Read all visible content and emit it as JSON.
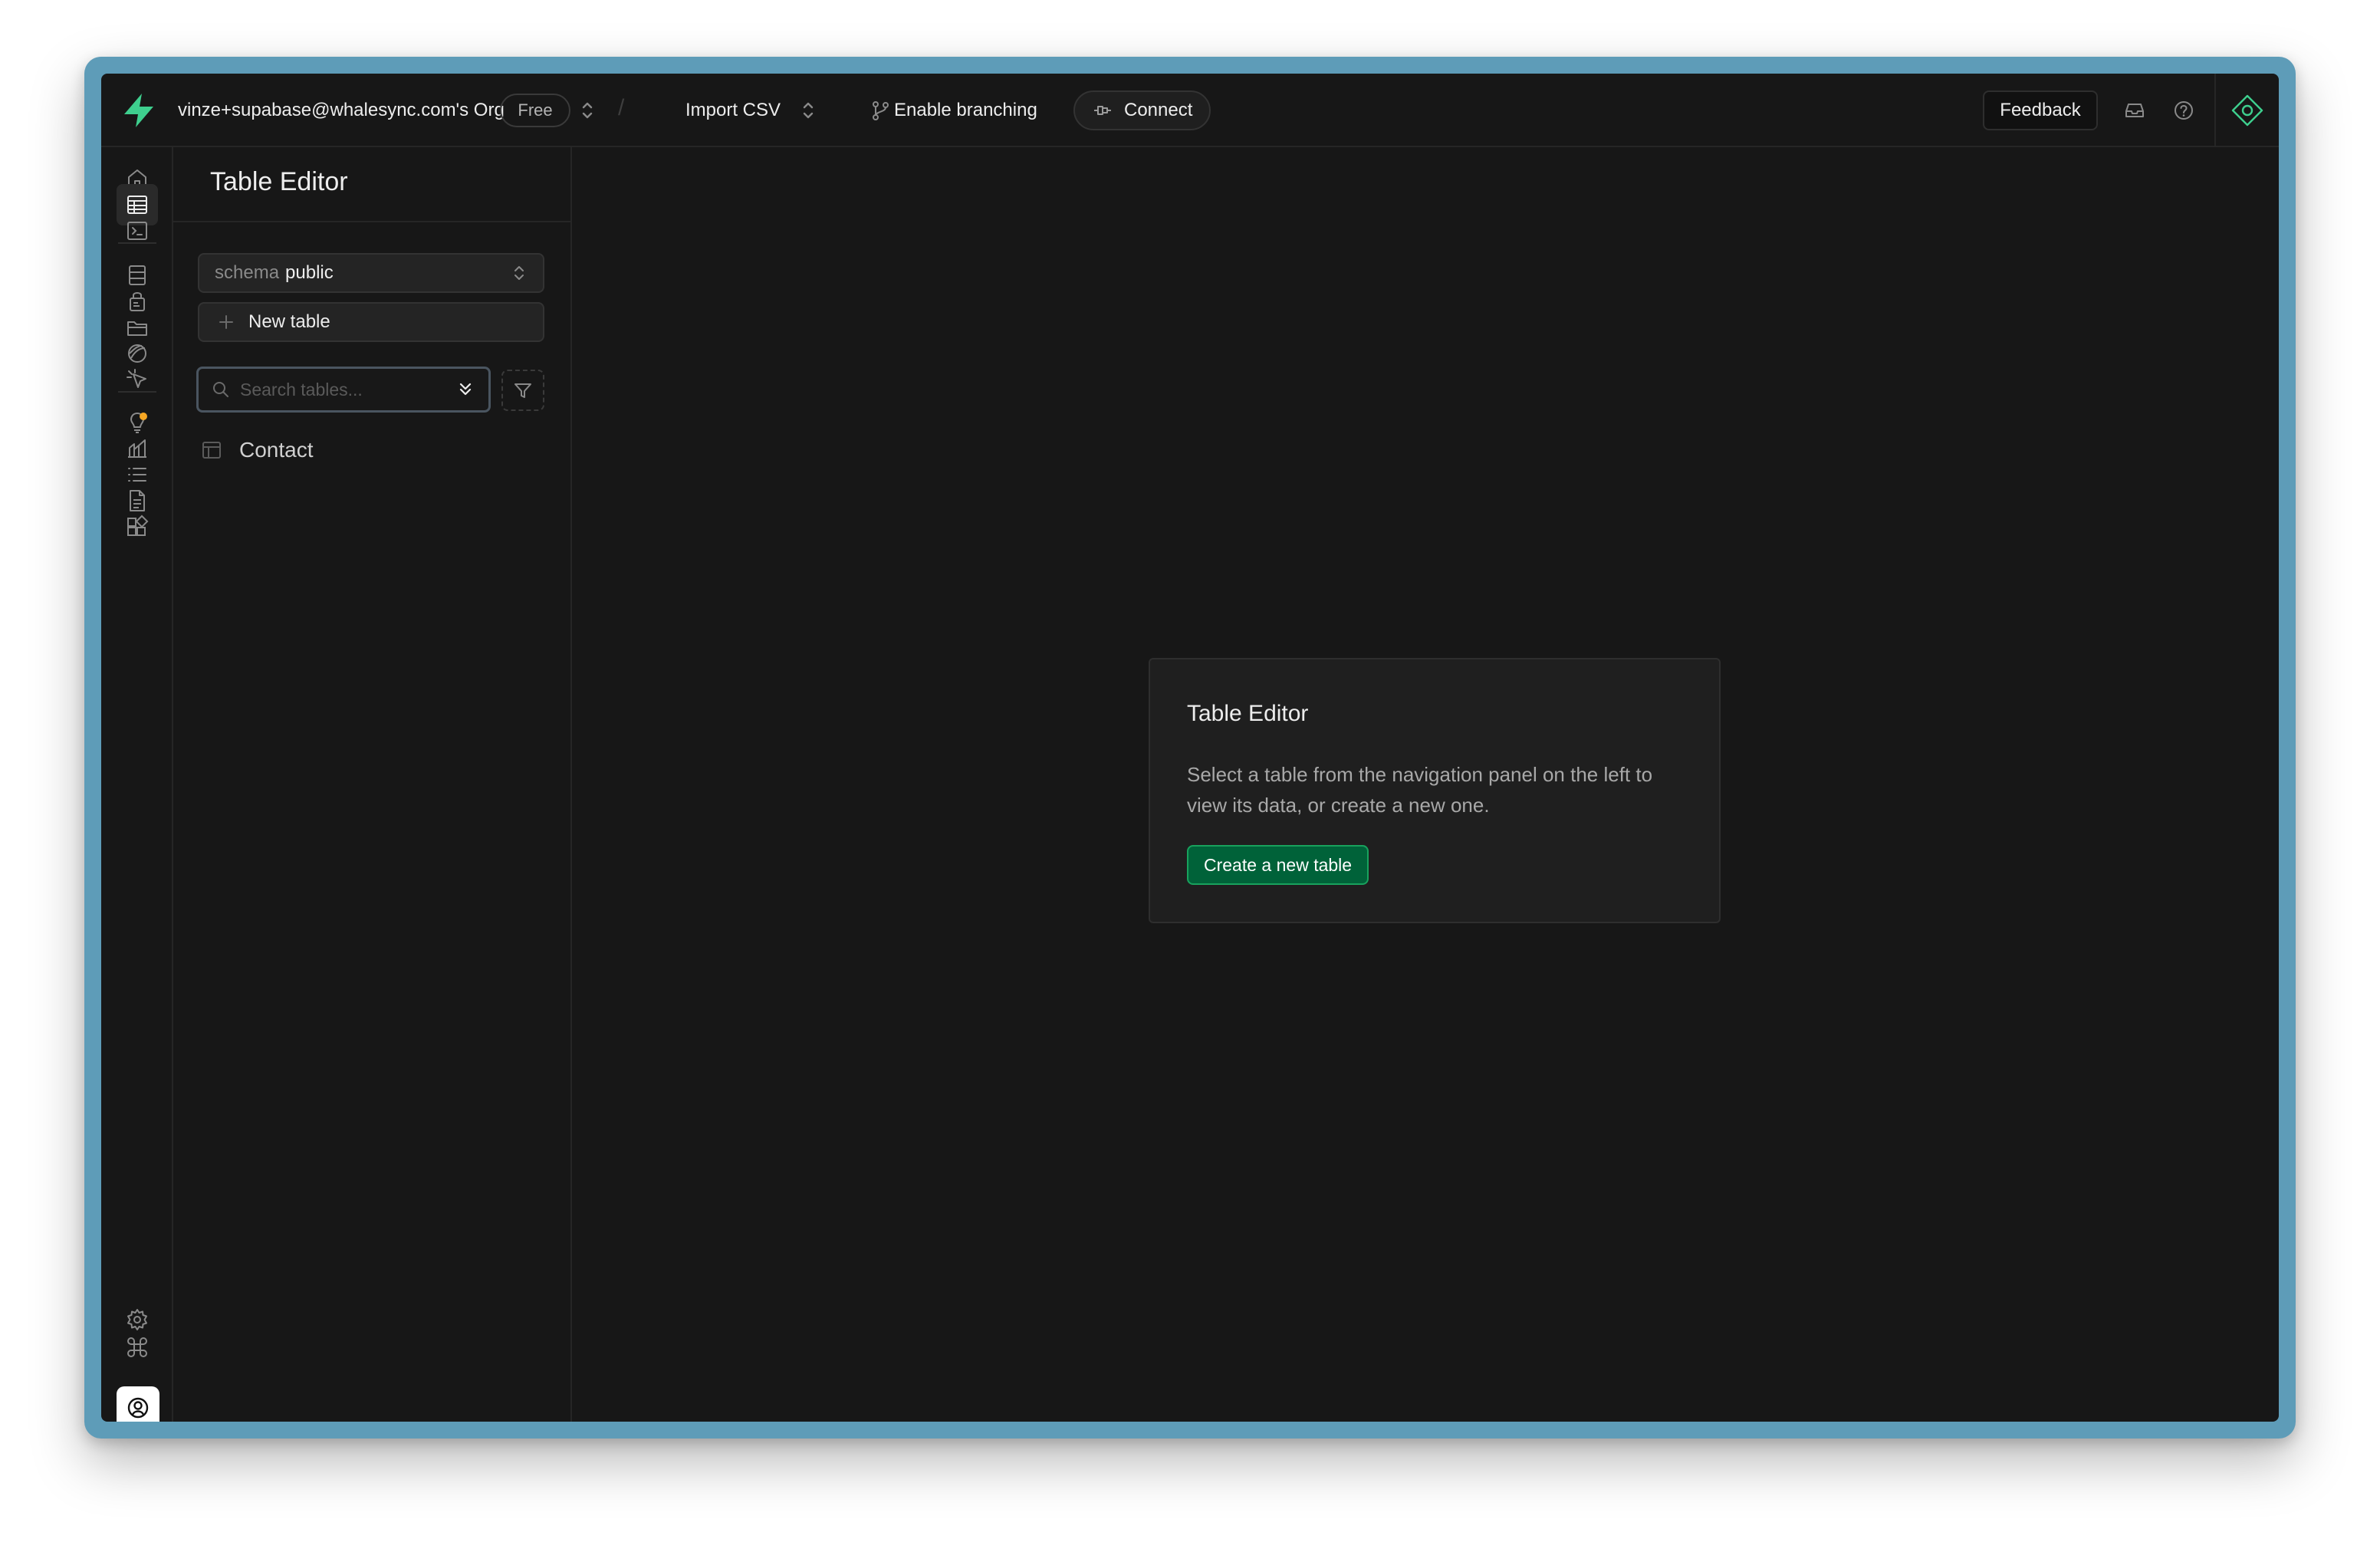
{
  "topbar": {
    "org_name": "vinze+supabase@whalesync.com's Org",
    "plan_badge": "Free",
    "project_name": "Import CSV",
    "branching_label": "Enable branching",
    "connect_label": "Connect",
    "feedback_label": "Feedback"
  },
  "icon_nav": {
    "items": [
      "home-icon",
      "table-editor-icon",
      "sql-editor-icon",
      "database-icon",
      "authentication-icon",
      "storage-icon",
      "realtime-icon",
      "edge-functions-icon",
      "advisors-icon",
      "reports-icon",
      "logs-icon",
      "api-docs-icon",
      "integrations-icon",
      "settings-icon",
      "command-icon",
      "avatar-icon",
      "collapse-sidebar-icon"
    ],
    "active": "table-editor-icon"
  },
  "sidepanel": {
    "title": "Table Editor",
    "schema_label": "schema",
    "schema_value": "public",
    "new_table_label": "New table",
    "search_placeholder": "Search tables...",
    "tables": [
      "Contact"
    ]
  },
  "main": {
    "card_title": "Table Editor",
    "card_description": "Select a table from the navigation panel on the left to view its data, or create a new one.",
    "create_button_label": "Create a new table"
  },
  "colors": {
    "accent_green": "#3ecf8e",
    "button_green": "#006239",
    "background": "#171717",
    "frame_blue": "#5e9cb8",
    "notification_dot": "#f5a623"
  }
}
